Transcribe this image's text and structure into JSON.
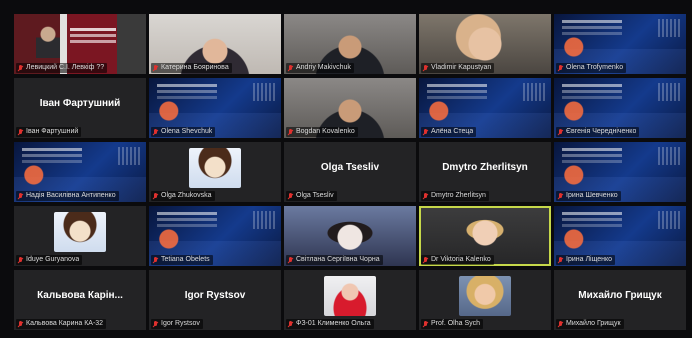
{
  "tiles": [
    {
      "label": "Левицкий С.І. Левкіф ??",
      "bg": "bg-webcam-ad",
      "center": "",
      "avatar": ""
    },
    {
      "label": "Катерина Бояринова",
      "bg": "bg-room",
      "center": "",
      "avatar": ""
    },
    {
      "label": "Andriy Makivchuk",
      "bg": "bg-dark-room",
      "center": "",
      "avatar": ""
    },
    {
      "label": "Vladimir Kapustyan",
      "bg": "bg-warm",
      "center": "",
      "avatar": ""
    },
    {
      "label": "Olena Trofymenko",
      "bg": "bg-slide",
      "center": "",
      "avatar": ""
    },
    {
      "label": "Іван Фартушний",
      "bg": "bg-avatar-panel",
      "center": "Іван Фартушний",
      "avatar": ""
    },
    {
      "label": "Olena Shevchuk",
      "bg": "bg-slide",
      "center": "",
      "avatar": ""
    },
    {
      "label": "Bogdan Kovalenko",
      "bg": "bg-dark-room",
      "center": "",
      "avatar": ""
    },
    {
      "label": "Алёна Стеца",
      "bg": "bg-slide",
      "center": "",
      "avatar": ""
    },
    {
      "label": "Євгенія Чередніченко",
      "bg": "bg-slide",
      "center": "",
      "avatar": ""
    },
    {
      "label": "Надія Василівна Антипенко",
      "bg": "bg-slide",
      "center": "",
      "avatar": ""
    },
    {
      "label": "Olga Zhukovska",
      "bg": "bg-avatar-panel",
      "center": "",
      "avatar": "cartoon"
    },
    {
      "label": "Olga Tsesliv",
      "bg": "bg-avatar-panel",
      "center": "Olga Tsesliv",
      "avatar": ""
    },
    {
      "label": "Dmytro Zherlitsyn",
      "bg": "bg-avatar-panel",
      "center": "Dmytro Zherlitsyn",
      "avatar": ""
    },
    {
      "label": "Ірина Шевченко",
      "bg": "bg-slide",
      "center": "",
      "avatar": ""
    },
    {
      "label": "Iduye Guryanova",
      "bg": "bg-avatar-panel",
      "center": "",
      "avatar": "cartoon"
    },
    {
      "label": "Tetiana Obelets",
      "bg": "bg-slide",
      "center": "",
      "avatar": ""
    },
    {
      "label": "Світлана Сергіївна Чорна",
      "bg": "bg-selfie",
      "center": "",
      "avatar": ""
    },
    {
      "label": "Dr Viktoria Kalenko",
      "bg": "bg-active",
      "center": "",
      "avatar": "",
      "active": true
    },
    {
      "label": "Ірина Ліщенко",
      "bg": "bg-slide",
      "center": "",
      "avatar": ""
    },
    {
      "label": "Кальвова Карина КА-32",
      "bg": "bg-avatar-panel",
      "center": "Кальвова Карін...",
      "avatar": ""
    },
    {
      "label": "Igor Rystsov",
      "bg": "bg-avatar-panel",
      "center": "Igor Rystsov",
      "avatar": ""
    },
    {
      "label": "ФЗ-01 Клименко Ольга",
      "bg": "bg-avatar-panel",
      "center": "",
      "avatar": "red"
    },
    {
      "label": "Prof. Olha Sych",
      "bg": "bg-avatar-panel",
      "center": "",
      "avatar": "blonde"
    },
    {
      "label": "Михайло Грищук",
      "bg": "bg-avatar-panel",
      "center": "Михайло Грищук",
      "avatar": ""
    }
  ],
  "colors": {
    "background": "#0b0b0d",
    "tile": "#232325",
    "active_outline": "#c6d84a",
    "mic_muted": "#e0312e"
  },
  "icons": {
    "label_icon": "muted-mic-icon"
  }
}
